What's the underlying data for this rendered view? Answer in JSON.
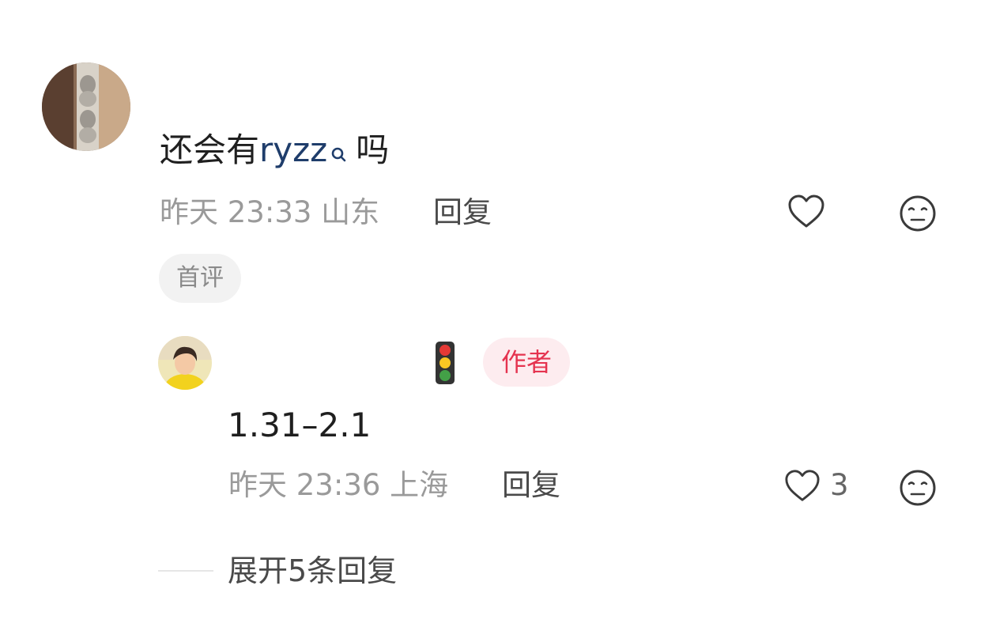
{
  "comment": {
    "text_prefix": "还会有",
    "keyword": "ryzz",
    "text_suffix": "吗",
    "date": "昨天",
    "time": "23:33",
    "location": "山东",
    "reply_label": "回复",
    "badge": "首评",
    "like_icon": "heart-outline-icon",
    "reaction_icon": "neutral-face-icon"
  },
  "reply": {
    "emoji_icon": "traffic-light-icon",
    "author_badge": "作者",
    "text": "1.31–2.1",
    "date": "昨天",
    "time": "23:36",
    "location": "上海",
    "reply_label": "回复",
    "like_count": "3",
    "like_icon": "heart-outline-icon",
    "reaction_icon": "neutral-face-icon"
  },
  "expand": {
    "label": "展开5条回复"
  },
  "colors": {
    "keyword": "#1f3d6b",
    "meta": "#9a9a9a",
    "author_badge_text": "#e5334f",
    "author_badge_bg": "#fdecef"
  }
}
